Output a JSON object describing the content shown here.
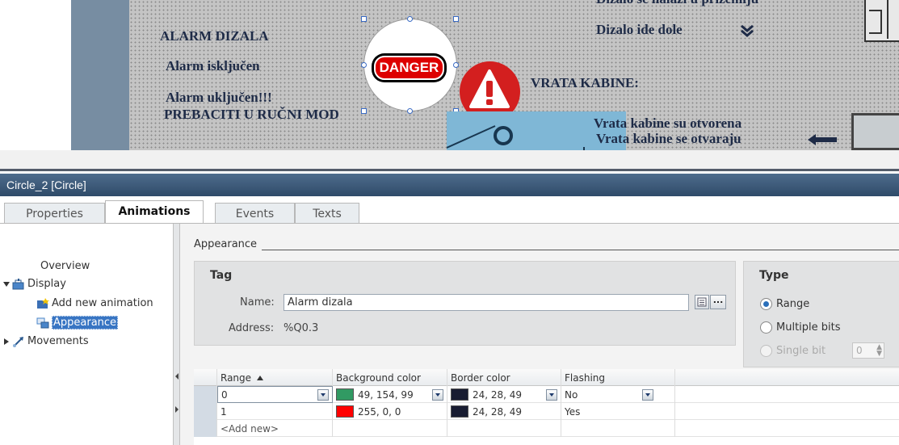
{
  "canvas": {
    "texts": {
      "alarm_heading": "ALARM DIZALA",
      "alarm_off": "Alarm isključen",
      "alarm_on": "Alarm uključen!!!",
      "switch_manual": "PREBACITI U RUČNI MOD",
      "elevator_ground": "Dizalo se nalazi u prizemlju",
      "elevator_down": "Dizalo ide dole",
      "cabin_doors": "VRATA KABINE:",
      "doors_open": "Vrata kabine su otvorena",
      "doors_opening": "Vrata kabine se otvaraju"
    },
    "danger_label": "DANGER"
  },
  "inspector": {
    "title": "Circle_2 [Circle]",
    "tabs": [
      "Properties",
      "Animations",
      "Events",
      "Texts"
    ],
    "active_tab": "Animations"
  },
  "tree": {
    "overview": "Overview",
    "display": "Display",
    "add_new_animation": "Add new animation",
    "appearance": "Appearance",
    "movements": "Movements"
  },
  "appearance": {
    "section_title": "Appearance",
    "tag": {
      "header": "Tag",
      "name_label": "Name:",
      "name_value": "Alarm dizala",
      "address_label": "Address:",
      "address_value": "%Q0.3"
    },
    "type": {
      "header": "Type",
      "options": [
        "Range",
        "Multiple bits",
        "Single bit"
      ],
      "selected": "Range",
      "single_bit_value": "0"
    },
    "grid": {
      "columns": [
        "Range",
        "Background color",
        "Border color",
        "Flashing"
      ],
      "rows": [
        {
          "range": "0",
          "bg_color_hex": "#319a63",
          "bg_color": "49, 154, 99",
          "border_color_hex": "#181c31",
          "border_color": "24, 28, 49",
          "flashing": "No"
        },
        {
          "range": "1",
          "bg_color_hex": "#ff0000",
          "bg_color": "255, 0, 0",
          "border_color_hex": "#181c31",
          "border_color": "24, 28, 49",
          "flashing": "Yes"
        }
      ],
      "add_new": "<Add new>"
    }
  }
}
